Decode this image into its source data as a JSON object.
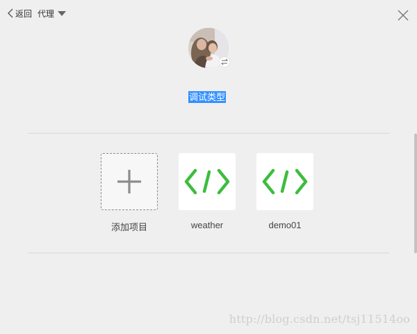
{
  "header": {
    "back_label": "返回",
    "proxy_label": "代理"
  },
  "profile": {
    "debug_type_label": "调试类型"
  },
  "projects": [
    {
      "name": "添加项目",
      "icon": "plus-icon"
    },
    {
      "name": "weather",
      "icon": "code-icon"
    },
    {
      "name": "demo01",
      "icon": "code-icon"
    }
  ],
  "colors": {
    "background": "#efefef",
    "code_icon_green": "#3dbd3d",
    "selection_blue": "#3390ff",
    "divider": "#d8d8d8"
  },
  "watermark": "http://blog.csdn.net/tsj11514oo"
}
